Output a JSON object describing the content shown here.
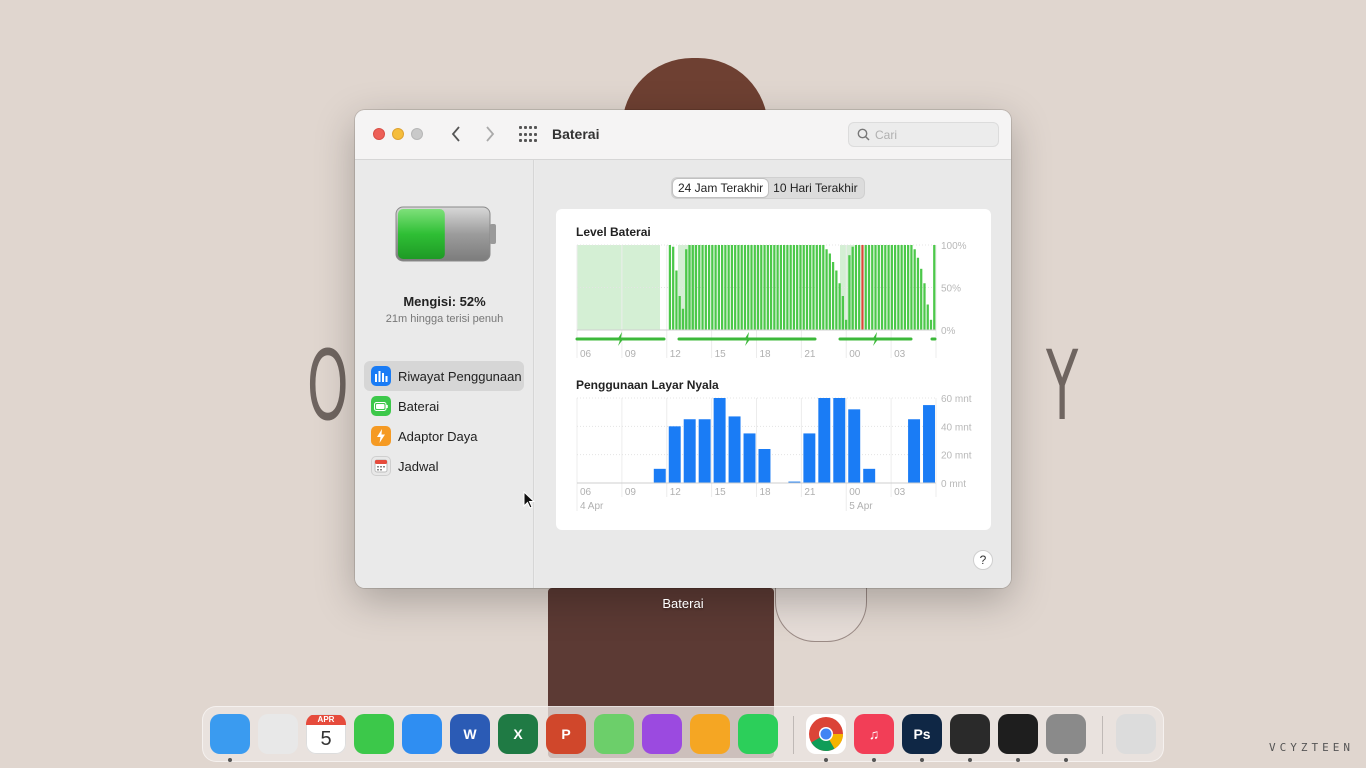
{
  "desktop": {
    "left_letter": "O",
    "right_letter": "Y",
    "watermark": "VCYZTEEN",
    "tooltip": "Baterai"
  },
  "window": {
    "title": "Baterai",
    "search": {
      "placeholder": "Cari",
      "value": ""
    }
  },
  "sidebar": {
    "charge_title": "Mengisi: 52%",
    "charge_subtitle": "21m hingga terisi penuh",
    "battery_level": 0.52,
    "items": [
      {
        "label": "Riwayat Penggunaan",
        "icon": "bar-chart-icon",
        "color": "#1a7cf5",
        "active": true
      },
      {
        "label": "Baterai",
        "icon": "battery-icon",
        "color": "#3cc84a",
        "active": false
      },
      {
        "label": "Adaptor Daya",
        "icon": "lightning-icon",
        "color": "#f59a23",
        "active": false
      },
      {
        "label": "Jadwal",
        "icon": "calendar-icon",
        "color": "#e8e8e8",
        "active": false
      }
    ]
  },
  "segments": [
    {
      "label": "24 Jam Terakhir",
      "active": true
    },
    {
      "label": "10 Hari Terakhir",
      "active": false
    }
  ],
  "help_label": "?",
  "chart_data": [
    {
      "type": "bar",
      "title": "Level Baterai",
      "y_ticks": [
        "100%",
        "50%",
        "0%"
      ],
      "ylim": [
        0,
        100
      ],
      "x_ticks": [
        "06",
        "09",
        "12",
        "15",
        "18",
        "21",
        "00",
        "03"
      ],
      "colors": {
        "bar": "#4cc84a",
        "low": "#d84a3a",
        "charging_bg": "#d4efd4",
        "charging_line": "#3cb83a"
      },
      "values": [
        0,
        0,
        0,
        0,
        0,
        0,
        0,
        0,
        0,
        0,
        0,
        0,
        0,
        0,
        0,
        0,
        0,
        0,
        0,
        0,
        0,
        0,
        0,
        0,
        0,
        0,
        0,
        0,
        100,
        98,
        70,
        40,
        25,
        95,
        100,
        100,
        100,
        100,
        100,
        100,
        100,
        100,
        100,
        100,
        100,
        100,
        100,
        100,
        100,
        100,
        100,
        100,
        100,
        100,
        100,
        100,
        100,
        100,
        100,
        100,
        100,
        100,
        100,
        100,
        100,
        100,
        100,
        100,
        100,
        100,
        100,
        100,
        100,
        100,
        100,
        100,
        95,
        90,
        80,
        70,
        55,
        40,
        12,
        88,
        98,
        100,
        100,
        100,
        100,
        100,
        100,
        100,
        100,
        100,
        100,
        100,
        100,
        100,
        100,
        100,
        100,
        100,
        100,
        95,
        85,
        72,
        55,
        30,
        12,
        100
      ],
      "low_indices": [
        87,
        117
      ]
    },
    {
      "type": "bar",
      "title": "Penggunaan Layar Nyala",
      "y_ticks": [
        "60 mnt",
        "40 mnt",
        "20 mnt",
        "0 mnt"
      ],
      "ylim": [
        0,
        60
      ],
      "x_ticks": [
        "06",
        "09",
        "12",
        "15",
        "18",
        "21",
        "00",
        "03"
      ],
      "date_labels": [
        "4 Apr",
        "5 Apr"
      ],
      "colors": {
        "bar": "#1a7cf5"
      },
      "values": [
        0,
        0,
        0,
        0,
        0,
        10,
        40,
        45,
        45,
        60,
        47,
        35,
        24,
        0,
        1,
        35,
        60,
        60,
        52,
        10,
        0,
        0,
        45,
        55
      ]
    }
  ],
  "dock": {
    "apps": [
      {
        "name": "finder",
        "label": "",
        "color": "#3a9bf0",
        "running": true
      },
      {
        "name": "launchpad",
        "label": "",
        "color": "#e8e8e8",
        "running": false
      },
      {
        "name": "calendar",
        "label": "5",
        "month": "APR",
        "color": "#ffffff",
        "running": false
      },
      {
        "name": "facetime",
        "label": "",
        "color": "#3cc84a",
        "running": false
      },
      {
        "name": "mail",
        "label": "",
        "color": "#2f8ef2",
        "running": false
      },
      {
        "name": "word",
        "label": "W",
        "color": "#2b5bb5",
        "running": false
      },
      {
        "name": "excel",
        "label": "X",
        "color": "#1f7a44",
        "running": false
      },
      {
        "name": "powerpoint",
        "label": "P",
        "color": "#d0472b",
        "running": false
      },
      {
        "name": "maps",
        "label": "",
        "color": "#6ccf6a",
        "running": false
      },
      {
        "name": "podcasts",
        "label": "",
        "color": "#9b4ae0",
        "running": false
      },
      {
        "name": "vlc",
        "label": "",
        "color": "#f5a623",
        "running": false
      },
      {
        "name": "whatsapp",
        "label": "",
        "color": "#2ccf5a",
        "running": false
      },
      {
        "name": "chrome",
        "label": "",
        "color": "#ffffff",
        "running": true
      },
      {
        "name": "music",
        "label": "♫",
        "color": "#f23e57",
        "running": true
      },
      {
        "name": "photoshop",
        "label": "Ps",
        "color": "#0f2745",
        "running": true
      },
      {
        "name": "piano",
        "label": "",
        "color": "#2a2a2a",
        "running": true
      },
      {
        "name": "activity-monitor",
        "label": "",
        "color": "#1e1e1e",
        "running": true
      },
      {
        "name": "system-preferences",
        "label": "",
        "color": "#8a8a8a",
        "running": true
      },
      {
        "name": "trash",
        "label": "",
        "color": "#dcdcdc",
        "running": false
      }
    ]
  }
}
